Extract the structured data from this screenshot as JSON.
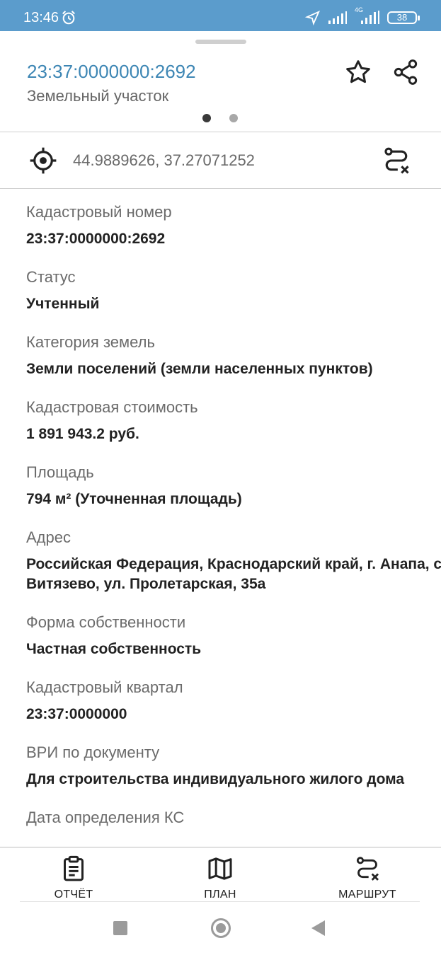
{
  "status_bar": {
    "time": "13:46",
    "battery": "38",
    "network": "4G"
  },
  "header": {
    "title": "23:37:0000000:2692",
    "subtitle": "Земельный участок",
    "favorite_icon": "star-icon",
    "share_icon": "share-icon",
    "pager_active_index": 0,
    "pager_count": 2
  },
  "coordinates": {
    "text": "44.9889626, 37.27071252",
    "locate_icon": "crosshair-icon",
    "route_icon": "route-icon"
  },
  "fields": [
    {
      "label": "Кадастровый номер",
      "value": "23:37:0000000:2692"
    },
    {
      "label": "Статус",
      "value": "Учтенный"
    },
    {
      "label": "Категория земель",
      "value": "Земли поселений (земли населенных пунктов)"
    },
    {
      "label": "Кадастровая стоимость",
      "value": "1 891 943.2 руб."
    },
    {
      "label": "Площадь",
      "value": "794 м² (Уточненная площадь)"
    },
    {
      "label": "Адрес",
      "value": "Российская Федерация, Краснодарский край, г. Анапа, с. Витязево, ул. Пролетарская, 35а"
    },
    {
      "label": "Форма собственности",
      "value": "Частная собственность"
    },
    {
      "label": "Кадастровый квартал",
      "value": "23:37:0000000"
    },
    {
      "label": "ВРИ по документу",
      "value": "Для строительства индивидуального жилого дома"
    },
    {
      "label": "Дата определения КС",
      "value": ""
    }
  ],
  "bottom_nav": {
    "report": "ОТЧЁТ",
    "plan": "ПЛАН",
    "route": "МАРШРУТ"
  },
  "colors": {
    "status_bar": "#5b9ccc",
    "title": "#3d86b4"
  }
}
